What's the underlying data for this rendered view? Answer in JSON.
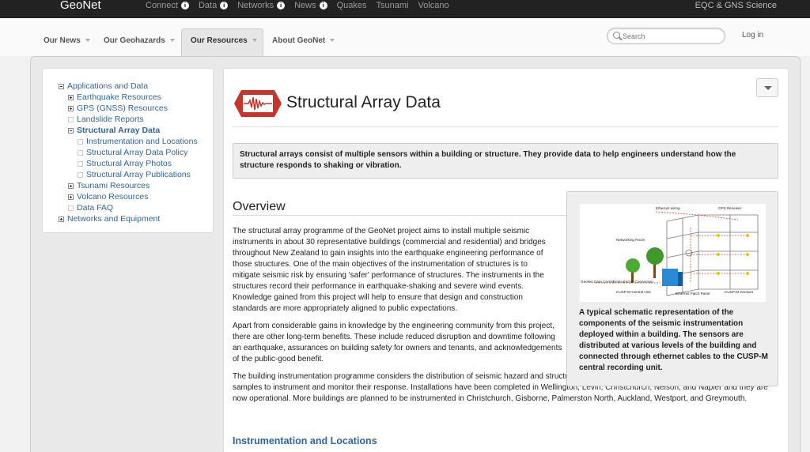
{
  "topbar": {
    "brand": "GeoNet",
    "nav": [
      {
        "label": "Connect",
        "info": true
      },
      {
        "label": "Data",
        "info": true
      },
      {
        "label": "Networks",
        "info": true
      },
      {
        "label": "News",
        "info": true
      },
      {
        "label": "Quakes",
        "info": false
      },
      {
        "label": "Tsunami",
        "info": false
      },
      {
        "label": "Volcano",
        "info": false
      }
    ],
    "right": "EQC & GNS Science"
  },
  "subnav": {
    "items": [
      {
        "label": "Our News",
        "active": false
      },
      {
        "label": "Our Geohazards",
        "active": false
      },
      {
        "label": "Our Resources",
        "active": true
      },
      {
        "label": "About GeoNet",
        "active": false
      }
    ],
    "search_placeholder": "Search",
    "login": "Log in"
  },
  "sidebar": {
    "items": [
      {
        "label": "Applications and Data",
        "level": 0,
        "toggle": "minus",
        "current": false
      },
      {
        "label": "Earthquake Resources",
        "level": 1,
        "toggle": "plus",
        "current": false
      },
      {
        "label": "GPS (GNSS) Resources",
        "level": 1,
        "toggle": "plus",
        "current": false
      },
      {
        "label": "Landslide Reports",
        "level": 1,
        "toggle": "empty",
        "current": false
      },
      {
        "label": "Structural Array Data",
        "level": 1,
        "toggle": "minus",
        "current": true
      },
      {
        "label": "Instrumentation and Locations",
        "level": 2,
        "toggle": "empty",
        "current": false
      },
      {
        "label": "Structural Array Data Policy",
        "level": 2,
        "toggle": "empty",
        "current": false
      },
      {
        "label": "Structural Array Photos",
        "level": 2,
        "toggle": "empty",
        "current": false
      },
      {
        "label": "Structural Array Publications",
        "level": 2,
        "toggle": "empty",
        "current": false
      },
      {
        "label": "Tsunami Resources",
        "level": 1,
        "toggle": "plus",
        "current": false
      },
      {
        "label": "Volcano Resources",
        "level": 1,
        "toggle": "plus",
        "current": false
      },
      {
        "label": "Data FAQ",
        "level": 1,
        "toggle": "empty",
        "current": false
      },
      {
        "label": "Networks and Equipment",
        "level": 0,
        "toggle": "plus",
        "current": false
      }
    ]
  },
  "main": {
    "title": "Structural Array Data",
    "intro": "Structural arrays consist of multiple sensors within a building or structure. They provide data to help engineers understand how the structure responds to shaking or vibration.",
    "overview_heading": "Overview",
    "paragraphs": [
      "The structural array programme of the GeoNet project aims to install multiple seismic instruments in about 30 representative buildings (commercial and residential) and bridges throughout New Zealand to gain insights into the earthquake engineering performance of those structures. One of the main objectives of the instrumentation of structures is to mitigate seismic risk by ensuring 'safer' performance of structures. The instruments in the structures record their performance in earthquake-shaking and severe wind events. Knowledge gained from this project will help to ensure that design and construction standards are more appropriately aligned to public expectations.",
      "Apart from considerable gains in knowledge by the engineering community from this project, there are other long-term benefits. These include reduced disruption and downtime following an earthquake, assurances on building safety for owners and tenants, and acknowledgements of the public-good benefit.",
      "The building instrumentation programme considers the distribution of seismic hazard and structures in New Zealand to identify typical and representative samples to instrument and monitor their response. Installations have been completed in Wellington, Levin, Christchurch, Nelson, and Napier and they are now operational. More buildings are planned to be instrumented in Christchurch, Gisborne, Palmerston North, Auckland, Westport, and Greymouth."
    ],
    "figure": {
      "labels": {
        "ethernet_wiring": "Ethernet wiring",
        "gps_receiver": "GPS Receiver",
        "networking_room": "Networking Room",
        "geonet_data_centre": "GeoNet Data Centre",
        "dedicated_ip": "Dedicated IP Connection",
        "cuspm_central": "CUSP-M Central Unit",
        "patch_panel": "Ethernet Patch Panel",
        "cuspm_sensors": "CUSP-M Sensors"
      },
      "caption": "A typical schematic representation of the components of the seismic instrumentation deployed within a building. The sensors are distributed at various levels of the building and connected through ethernet cables to the CUSP-M central recording unit."
    },
    "subheading": "Instrumentation and Locations"
  }
}
